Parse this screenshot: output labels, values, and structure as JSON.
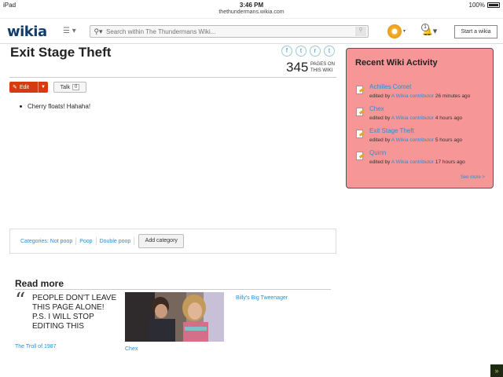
{
  "status_bar": {
    "device": "iPad",
    "time": "3:46 PM",
    "battery": "100%"
  },
  "browser": {
    "url": "thethundermans.wikia.com"
  },
  "header": {
    "logo": "wikia",
    "menu_icon": "☰ ▾",
    "search_placeholder": "Search within The Thundermans Wiki...",
    "notification_count": "1",
    "start_wiki_label": "Start a wikia"
  },
  "article": {
    "title": "Exit Stage Theft",
    "social_icons": [
      "facebook-icon",
      "twitter-icon",
      "reddit-icon",
      "tumblr-icon"
    ],
    "social_glyphs": [
      "f",
      "t",
      "r",
      "t"
    ],
    "pages_count": "345",
    "pages_label_line1": "PAGES ON",
    "pages_label_line2": "THIS WIKI",
    "edit_label": "Edit",
    "talk_label": "Talk",
    "talk_count": "0",
    "bullets": [
      "Cherry floats! Hahaha!"
    ]
  },
  "categories": {
    "label": "Categories:",
    "items": [
      "Not poop",
      "Poop",
      "Double poop"
    ],
    "add_label": "Add category"
  },
  "read_more": {
    "title": "Read more",
    "quote": "PEOPLE DON'T LEAVE THIS PAGE ALONE! P.S. I WILL STOP EDITING THIS",
    "items": [
      {
        "label": "The Troll of 1987"
      },
      {
        "label": "Chex"
      },
      {
        "label": "Billy's Big Tweenager"
      }
    ]
  },
  "sidebar": {
    "title": "Recent Wiki Activity",
    "activities": [
      {
        "title": "Achilles Comet",
        "prefix": "edited by",
        "user": "A Wikia contributor",
        "time": "26 minutes ago"
      },
      {
        "title": "Chex",
        "prefix": "edited by",
        "user": "A Wikia contributor",
        "time": "4 hours ago"
      },
      {
        "title": "Exit Stage Theft",
        "prefix": "edited by",
        "user": "A Wikia contributor",
        "time": "5 hours ago"
      },
      {
        "title": "Quinn",
        "prefix": "edited by",
        "user": "A Wikia contributor",
        "time": "17 hours ago"
      }
    ],
    "see_more": "See more >"
  },
  "colors": {
    "edit_button": "#d63a10",
    "sidebar_bg": "#f79696",
    "link": "#2a8ed0",
    "logo": "#143c6b"
  }
}
